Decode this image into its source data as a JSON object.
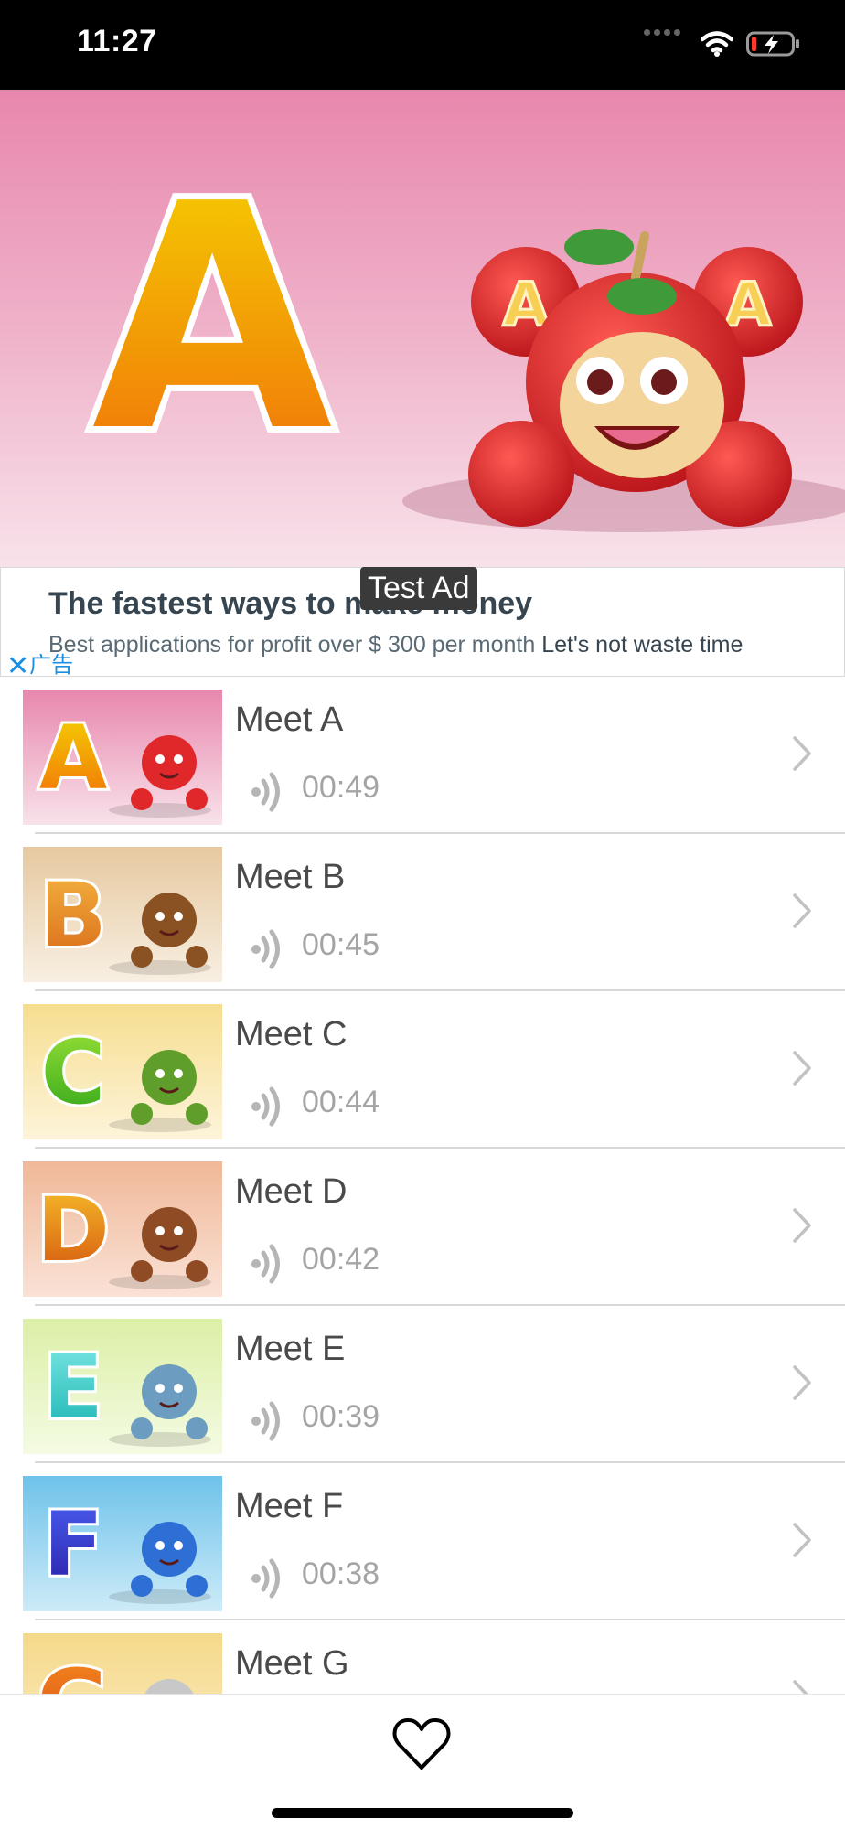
{
  "status_bar": {
    "time": "11:27",
    "icons": [
      "signal-dots-icon",
      "wifi-icon",
      "battery-charging-icon"
    ]
  },
  "hero": {
    "letter": "A",
    "mascot_letters": [
      "A",
      "A"
    ],
    "colors": {
      "bg_top": "#e887ad",
      "bg_bottom": "#f8e2ea",
      "letter_top": "#f5d400",
      "letter_bottom": "#f06d0a"
    }
  },
  "ad": {
    "headline": "The fastest ways to make money",
    "description": "Best applications for profit over $ 300 per month",
    "cta": "Let's not waste time",
    "close_label": "广告",
    "test_label": "Test Ad"
  },
  "items": [
    {
      "title": "Meet A",
      "duration": "00:49",
      "letter": "A",
      "bg": [
        "#e887ad",
        "#f8e2ea"
      ],
      "letter_color": [
        "#f5d400",
        "#f06d0a"
      ],
      "mascot": "#e0282a"
    },
    {
      "title": "Meet B",
      "duration": "00:45",
      "letter": "B",
      "bg": [
        "#e6c9a0",
        "#f8efe2"
      ],
      "letter_color": [
        "#f5b640",
        "#d86818"
      ],
      "mascot": "#8a5223"
    },
    {
      "title": "Meet C",
      "duration": "00:44",
      "letter": "C",
      "bg": [
        "#f6de8f",
        "#fdf4da"
      ],
      "letter_color": [
        "#9be236",
        "#2fa41a"
      ],
      "mascot": "#5f9e2a"
    },
    {
      "title": "Meet D",
      "duration": "00:42",
      "letter": "D",
      "bg": [
        "#f0b898",
        "#fae2d6"
      ],
      "letter_color": [
        "#f7c12a",
        "#d4530e"
      ],
      "mascot": "#8e4b24"
    },
    {
      "title": "Meet E",
      "duration": "00:39",
      "letter": "E",
      "bg": [
        "#dcefa6",
        "#f4fbe3"
      ],
      "letter_color": [
        "#7de8e6",
        "#18b3b0"
      ],
      "mascot": "#6c9dc0"
    },
    {
      "title": "Meet F",
      "duration": "00:38",
      "letter": "F",
      "bg": [
        "#6ec2ea",
        "#cdebf8"
      ],
      "letter_color": [
        "#4a5ef0",
        "#2a1fa8"
      ],
      "mascot": "#2e6fd6"
    },
    {
      "title": "Meet G",
      "duration": "",
      "letter": "G",
      "bg": [
        "#f5d98a",
        "#fbedc4"
      ],
      "letter_color": [
        "#f48a20",
        "#d84310"
      ],
      "mascot": "#c8c8c8"
    }
  ],
  "bottom_bar": {
    "favorite_icon": "heart-icon"
  }
}
